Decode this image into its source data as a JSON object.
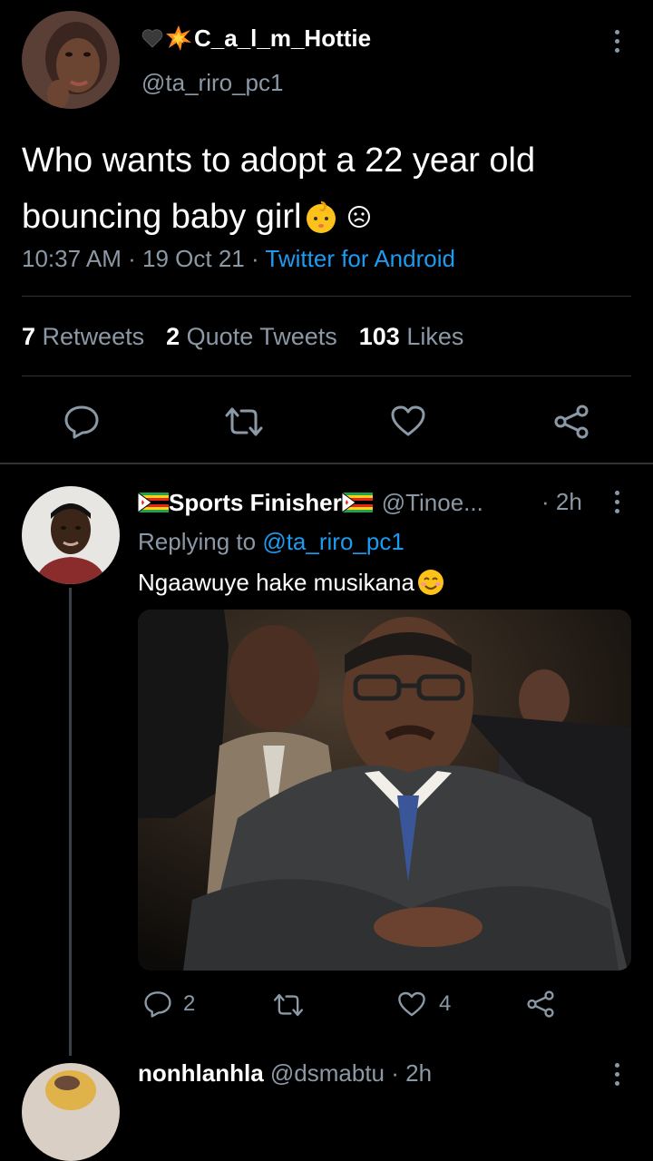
{
  "main_tweet": {
    "display_name": "C_a_l_m_Hottie",
    "name_prefix_emojis": [
      "black-heart",
      "collision"
    ],
    "handle": "@ta_riro_pc1",
    "text_line1": "Who wants to adopt a 22 year old",
    "text_line2": "bouncing baby girl",
    "text_emojis": [
      "baby",
      "frowning-face"
    ],
    "time": "10:37 AM",
    "sep": "·",
    "date": "19 Oct 21",
    "source": "Twitter for Android",
    "stats": {
      "retweets_count": "7",
      "retweets_label": "Retweets",
      "quotes_count": "2",
      "quotes_label": "Quote Tweets",
      "likes_count": "103",
      "likes_label": "Likes"
    }
  },
  "reply": {
    "display_name": "Sports Finisher",
    "name_flags": [
      "zimbabwe-flag",
      "zimbabwe-flag"
    ],
    "handle": "@Tinoe...",
    "time": "· 2h",
    "replying_prefix": "Replying to",
    "replying_handle": "@ta_riro_pc1",
    "text": "Ngaawuye hake musikana",
    "text_emoji": "smiling-face",
    "reply_count": "2",
    "like_count": "4"
  },
  "next_reply": {
    "display_name": "nonhlanhla",
    "handle": "@dsmabtu",
    "time": "· 2h"
  },
  "colors": {
    "background": "#000000",
    "muted": "#8b98a5",
    "link": "#1d9bf0",
    "divider": "#2f3336"
  }
}
